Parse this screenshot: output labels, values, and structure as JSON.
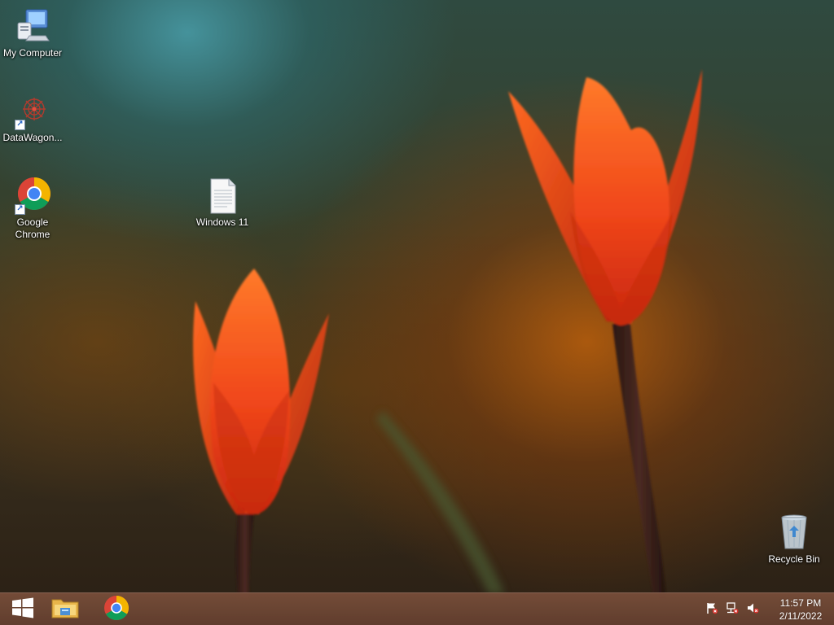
{
  "desktop": {
    "icons": [
      {
        "name": "my-computer",
        "label": "My Computer",
        "icon": "computer-icon"
      },
      {
        "name": "datawagon",
        "label": "DataWagon...",
        "icon": "datawagon-icon"
      },
      {
        "name": "google-chrome",
        "label": "Google Chrome",
        "icon": "chrome-icon"
      },
      {
        "name": "windows-11-file",
        "label": "Windows 11",
        "icon": "text-file-icon"
      },
      {
        "name": "recycle-bin",
        "label": "Recycle Bin",
        "icon": "recycle-bin-icon"
      }
    ]
  },
  "taskbar": {
    "start": {
      "icon": "windows-logo-icon"
    },
    "pinned": [
      {
        "name": "file-explorer",
        "icon": "folder-icon"
      },
      {
        "name": "chrome",
        "icon": "chrome-icon"
      }
    ],
    "tray": [
      {
        "name": "action-center",
        "icon": "flag-icon"
      },
      {
        "name": "network",
        "icon": "network-icon"
      },
      {
        "name": "volume",
        "icon": "speaker-muted-icon"
      }
    ],
    "clock": {
      "time": "11:57 PM",
      "date": "2/11/2022"
    }
  },
  "colors": {
    "taskbar": "#6e4634",
    "label_text": "#ffffff",
    "tulip": "#e6451a"
  }
}
